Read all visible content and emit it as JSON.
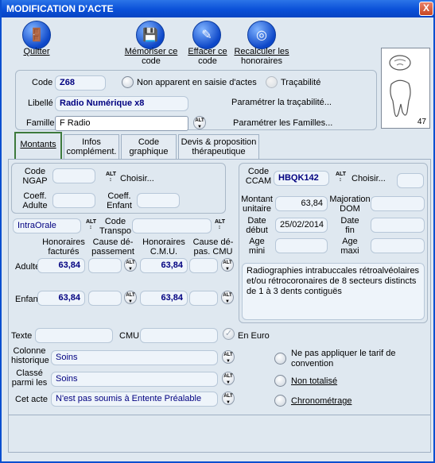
{
  "window": {
    "title": "MODIFICATION D'ACTE",
    "close_label": "X"
  },
  "toolbar": {
    "quit": {
      "label": "Quitter",
      "icon": "door-exit-icon"
    },
    "memorize": {
      "label_line1": "Mémoriser ce",
      "label_line2": "code",
      "icon": "floppy-disk-icon"
    },
    "erase": {
      "label_line1": "Effacer ce",
      "label_line2": "code",
      "icon": "eraser-icon"
    },
    "recalc": {
      "label_line1": "Recalculer les",
      "label_line2": "honoraires",
      "icon": "life-ring-icon"
    }
  },
  "header": {
    "code_label": "Code",
    "code_value": "Z68",
    "non_apparent_label": "Non apparent en saisie d'actes",
    "tracabilite_label": "Traçabilité",
    "libelle_label": "Libellé",
    "libelle_value": "Radio Numérique x8",
    "param_tracabilite": "Paramétrer la traçabilité...",
    "famille_label": "Famille",
    "famille_value": "F Radio",
    "param_familles": "Paramétrer les Familles...",
    "tooth_number": "47"
  },
  "tabs": [
    {
      "label_line1": "Montants",
      "label_line2": ""
    },
    {
      "label_line1": "Infos",
      "label_line2": "complément."
    },
    {
      "label_line1": "Code",
      "label_line2": "graphique"
    },
    {
      "label_line1": "Devis & proposition",
      "label_line2": "thérapeutique"
    }
  ],
  "ngap": {
    "code_label_1": "Code",
    "code_label_2": "NGAP",
    "choisir": "Choisir...",
    "coeff_adulte_1": "Coeff.",
    "coeff_adulte_2": "Adulte",
    "coeff_enfant_1": "Coeff.",
    "coeff_enfant_2": "Enfant"
  },
  "ccam": {
    "code_label_1": "Code",
    "code_label_2": "CCAM",
    "code_value": "HBQK142",
    "choisir": "Choisir...",
    "montant_1": "Montant",
    "montant_2": "unitaire",
    "montant_value": "63,84",
    "majoration_1": "Majoration",
    "majoration_2": "DOM",
    "date_debut_1": "Date",
    "date_debut_2": "début",
    "date_debut_value": "25/02/2014",
    "date_fin_1": "Date",
    "date_fin_2": "fin",
    "age_mini_1": "Age",
    "age_mini_2": "mini",
    "age_maxi_1": "Age",
    "age_maxi_2": "maxi",
    "description": "Radiographies intrabuccales rétroalvéolaires et/ou rétrocoronaires de 8 secteurs distincts de 1 à 3 dents contiguës"
  },
  "tarifs": {
    "type_value": "IntraOrale",
    "code_transpo_1": "Code",
    "code_transpo_2": "Transpo",
    "col_hon_fact_1": "Honoraires",
    "col_hon_fact_2": "facturés",
    "col_cause_dep_1": "Cause dé-",
    "col_cause_dep_2": "passement",
    "col_hon_cmu_1": "Honoraires",
    "col_hon_cmu_2": "C.M.U.",
    "col_cause_cmu_1": "Cause dé-",
    "col_cause_cmu_2": "pas. CMU",
    "adulte_label": "Adulte",
    "adulte_hon": "63,84",
    "adulte_cmu": "63,84",
    "enfant_label": "Enfant",
    "enfant_hon": "63,84",
    "enfant_cmu": "63,84"
  },
  "bottom": {
    "texte_label": "Texte",
    "cmu_label": "CMU",
    "en_euro_label": "En Euro",
    "colonne_1": "Colonne",
    "colonne_2": "historique",
    "colonne_value": "Soins",
    "classe_1": "Classé",
    "classe_2": "parmi les",
    "classe_value": "Soins",
    "cet_acte_label": "Cet acte",
    "cet_acte_value": "N'est pas soumis à Entente Préalable",
    "ne_pas_appliquer_1": "Ne pas appliquer le tarif de",
    "ne_pas_appliquer_2": "convention",
    "non_totalise": "Non totalisé",
    "chronometrage": "Chronométrage"
  },
  "alt": {
    "text": "ALT"
  }
}
